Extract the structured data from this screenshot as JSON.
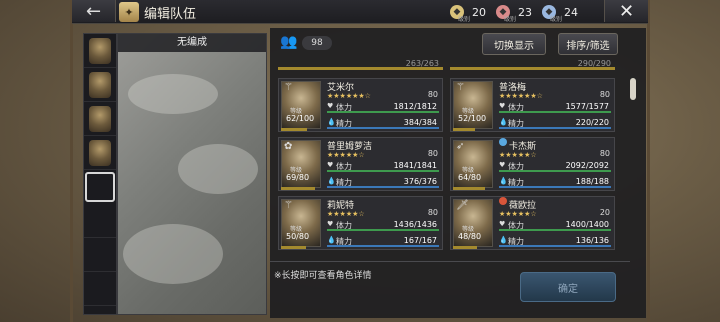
{
  "header": {
    "back_icon": "back-arrow-icon",
    "title": "编辑队伍",
    "close_icon": "close-icon",
    "resources": [
      {
        "icon": "badge-gold-icon",
        "sublabel": "级别",
        "value": "20",
        "color": "#d9c27a"
      },
      {
        "icon": "badge-red-icon",
        "sublabel": "级别",
        "value": "23",
        "color": "#d98a8a"
      },
      {
        "icon": "badge-blue-icon",
        "sublabel": "级别",
        "value": "24",
        "color": "#9ab8e0"
      }
    ]
  },
  "party": {
    "label": "无编成"
  },
  "roster": {
    "count": "98",
    "switch_label": "切换显示",
    "sort_label": "排序/筛选",
    "partial_top": [
      "263/263",
      "290/290"
    ],
    "characters": [
      {
        "name": "艾米尔",
        "stars": "★★★★★★☆",
        "level": "80",
        "lv_label": "等级",
        "lv": "62/100",
        "hp_label": "体力",
        "hp": "1812/1812",
        "sp_label": "精力",
        "sp": "384/384",
        "job_icon": "staff-icon"
      },
      {
        "name": "普洛梅",
        "stars": "★★★★★★☆",
        "level": "80",
        "lv_label": "等级",
        "lv": "52/100",
        "hp_label": "体力",
        "hp": "1577/1577",
        "sp_label": "精力",
        "sp": "220/220",
        "job_icon": "staff-icon"
      },
      {
        "name": "普里姆萝洁",
        "stars": "★★★★★☆",
        "level": "80",
        "lv_label": "等级",
        "lv": "69/80",
        "hp_label": "体力",
        "hp": "1841/1841",
        "sp_label": "精力",
        "sp": "376/376",
        "job_icon": "fan-icon"
      },
      {
        "name": "卡杰斯",
        "stars": "★★★★★☆",
        "level": "80",
        "lv_label": "等级",
        "lv": "64/80",
        "hp_label": "体力",
        "hp": "2092/2092",
        "sp_label": "精力",
        "sp": "188/188",
        "job_icon": "bow-icon"
      },
      {
        "name": "莉妮特",
        "stars": "★★★★★☆",
        "level": "80",
        "lv_label": "等级",
        "lv": "50/80",
        "hp_label": "体力",
        "hp": "1436/1436",
        "sp_label": "精力",
        "sp": "167/167",
        "job_icon": "staff-icon"
      },
      {
        "name": "薇欧拉",
        "stars": "★★★★★☆",
        "level": "20",
        "lv_label": "等级",
        "lv": "48/80",
        "hp_label": "体力",
        "hp": "1400/1400",
        "sp_label": "精力",
        "sp": "136/136",
        "job_icon": "dagger-icon"
      }
    ],
    "hint": "※长按即可查看角色详情",
    "confirm_label": "确定"
  }
}
